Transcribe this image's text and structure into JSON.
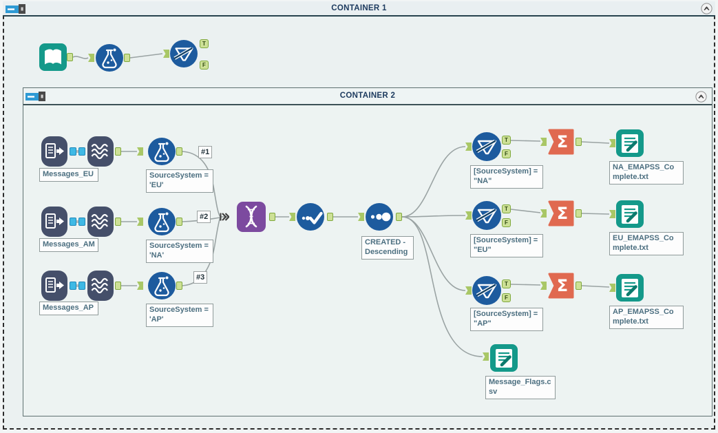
{
  "container1": {
    "title": "CONTAINER 1"
  },
  "container2": {
    "title": "CONTAINER 2"
  },
  "anchor_labels": {
    "t": "T",
    "f": "F"
  },
  "icons": {
    "summarize_sigma": "Σ"
  },
  "colors": {
    "canvas": "#f2f5f5",
    "container_fill": "#ebf1f1",
    "container2_border": "#5e7070",
    "teal_tool": "#14998a",
    "blue_tool": "#1d5b9e",
    "indb_tool": "#454f6a",
    "purple_tool": "#7c4a9f",
    "orange_tool": "#e06950",
    "anchor_green": "#cde096",
    "anchor_cyan": "#3fb9e5",
    "wire": "#9aa3a3",
    "annotation_text": "#4c6f80",
    "title_text": "#1c3a5e"
  },
  "left_rows": [
    {
      "message": "Messages_EU",
      "formula": "SourceSystem = 'EU'",
      "wire_label": "#1"
    },
    {
      "message": "Messages_AM",
      "formula": "SourceSystem = 'NA'",
      "wire_label": "#2"
    },
    {
      "message": "Messages_AP",
      "formula": "SourceSystem = 'AP'",
      "wire_label": "#3"
    }
  ],
  "sort_annotation": "CREATED - Descending",
  "right_rows": [
    {
      "filter": "[SourceSystem] = \"NA\"",
      "output": "NA_EMAPSS_Complete.txt"
    },
    {
      "filter": "[SourceSystem] = \"EU\"",
      "output": "EU_EMAPSS_Complete.txt"
    },
    {
      "filter": "[SourceSystem] = \"AP\"",
      "output": "AP_EMAPSS_Complete.txt"
    }
  ],
  "flags_output": "Message_Flags.csv"
}
